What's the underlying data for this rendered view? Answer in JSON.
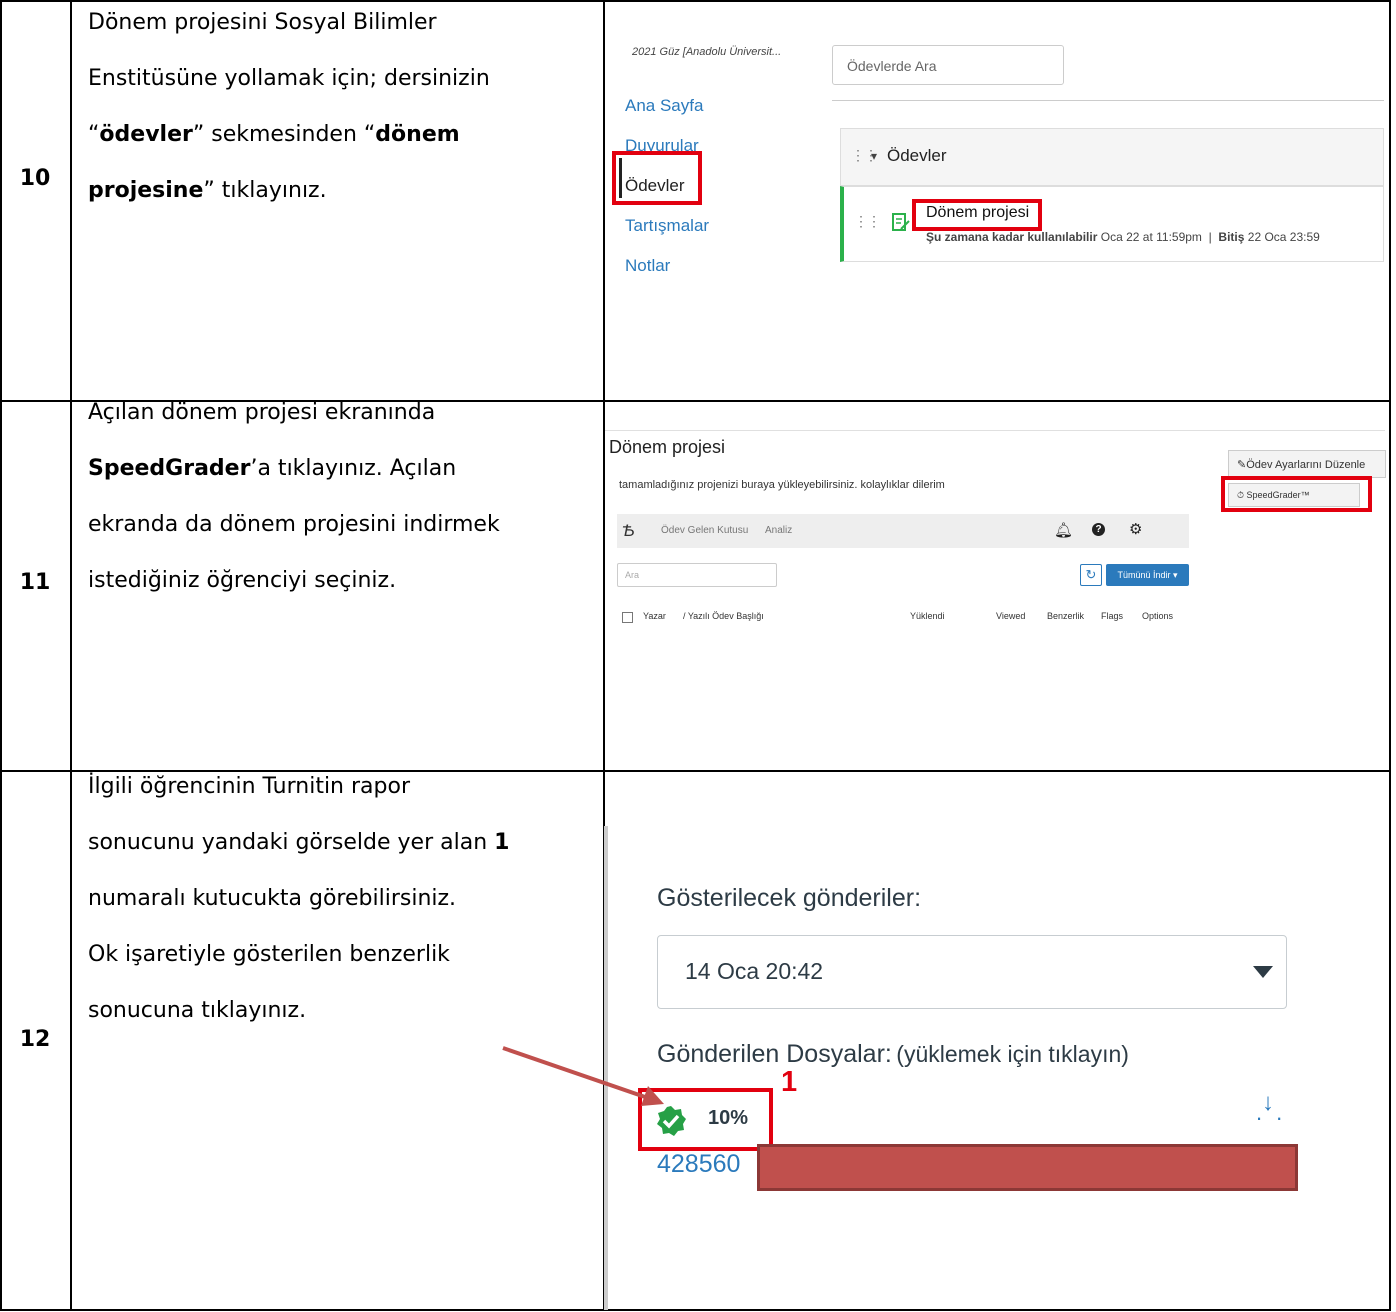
{
  "rows": [
    {
      "number": "10",
      "lines": [
        {
          "parts": [
            {
              "t": "Dönem projesini Sosyal Bilimler",
              "b": false
            }
          ]
        },
        {
          "parts": [
            {
              "t": "Enstitüsüne yollamak için; dersinizin",
              "b": false
            }
          ]
        },
        {
          "parts": [
            {
              "t": "“",
              "b": false
            },
            {
              "t": "ödevler",
              "b": true
            },
            {
              "t": "” sekmesinden “",
              "b": false
            },
            {
              "t": "dönem",
              "b": true
            }
          ]
        },
        {
          "parts": [
            {
              "t": "projesine",
              "b": true
            },
            {
              "t": "” tıklayınız.",
              "b": false
            }
          ]
        }
      ]
    },
    {
      "number": "11",
      "lines": [
        {
          "parts": [
            {
              "t": "Açılan dönem projesi ekranında",
              "b": false
            }
          ]
        },
        {
          "parts": [
            {
              "t": "SpeedGrader",
              "b": true
            },
            {
              "t": "’a tıklayınız. Açılan",
              "b": false
            }
          ]
        },
        {
          "parts": [
            {
              "t": "ekranda da dönem projesini indirmek",
              "b": false
            }
          ]
        },
        {
          "parts": [
            {
              "t": "istediğiniz öğrenciyi seçiniz.",
              "b": false
            }
          ]
        }
      ]
    },
    {
      "number": "12",
      "lines": [
        {
          "parts": [
            {
              "t": "İlgili öğrencinin Turnitin rapor",
              "b": false
            }
          ]
        },
        {
          "parts": [
            {
              "t": "sonucunu yandaki görselde yer alan ",
              "b": false
            },
            {
              "t": "1",
              "b": true
            }
          ]
        },
        {
          "parts": [
            {
              "t": "numaralı kutucukta görebilirsiniz.",
              "b": false
            }
          ]
        },
        {
          "parts": [
            {
              "t": "Ok işaretiyle gösterilen benzerlik",
              "b": false
            }
          ]
        },
        {
          "parts": [
            {
              "t": "sonucuna tıklayınız.",
              "b": false
            }
          ]
        }
      ]
    }
  ],
  "shot1": {
    "course": "2021 Güz [Anadolu Üniversit...",
    "search_placeholder": "Ödevlerde Ara",
    "nav": [
      "Ana Sayfa",
      "Duyurular",
      "Ödevler",
      "Tartışmalar",
      "Notlar"
    ],
    "group_title": "Ödevler",
    "assignment_title": "Dönem projesi",
    "avail_label": "Şu zamana kadar kullanılabilir",
    "avail_value": "Oca 22 at 11:59pm",
    "due_label": "Bitiş",
    "due_value": "22 Oca 23:59"
  },
  "shot2": {
    "title": "Dönem projesi",
    "edit_button": "Ödev Ayarlarını Düzenle",
    "speedgrader_button": "SpeedGrader™",
    "description": "tamamladığınız projenizi buraya yükleyebilirsiniz. kolaylıklar dilerim",
    "tab_inbox": "Ödev Gelen Kutusu",
    "tab_analysis": "Analiz",
    "search_placeholder": "Ara",
    "download_all": "Tümünü İndir",
    "columns": [
      "Yazar",
      "/ Yazılı Ödev Başlığı",
      "Yüklendi",
      "Viewed",
      "Benzerlik",
      "Flags",
      "Options"
    ]
  },
  "shot3": {
    "heading": "Gösterilecek gönderiler:",
    "selected_submission": "14 Oca 20:42",
    "files_label": "Gönderilen Dosyalar:",
    "files_hint": "(yüklemek için tıklayın)",
    "similarity": "10%",
    "file_name": "428560",
    "annotation_number": "1"
  }
}
